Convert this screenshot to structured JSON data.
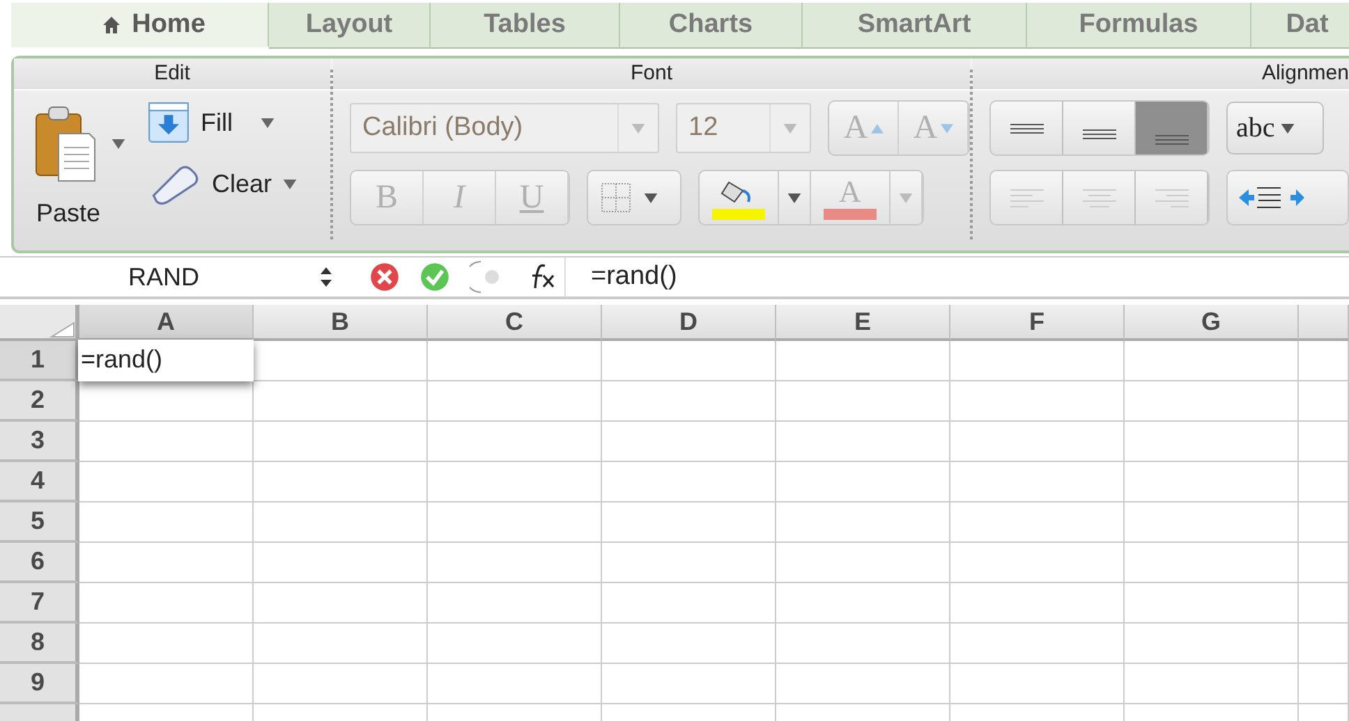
{
  "tabs": [
    {
      "label": "Home",
      "kind": "home",
      "selected": true
    },
    {
      "label": "Layout",
      "kind": "plain",
      "selected": false
    },
    {
      "label": "Tables",
      "kind": "plain",
      "selected": false
    },
    {
      "label": "Charts",
      "kind": "plain",
      "selected": false
    },
    {
      "label": "SmartArt",
      "kind": "plain",
      "selected": false
    },
    {
      "label": "Formulas",
      "kind": "plain",
      "selected": false
    },
    {
      "label": "Dat",
      "kind": "plain",
      "selected": false
    }
  ],
  "ribbon": {
    "edit": {
      "title": "Edit",
      "paste": "Paste",
      "fill": "Fill",
      "clear": "Clear"
    },
    "font": {
      "title": "Font",
      "font_name": "Calibri (Body)",
      "font_size": "12",
      "grow": "A",
      "shrink": "A",
      "bold": "B",
      "italic": "I",
      "underline": "U",
      "font_color": "A",
      "disabled": true
    },
    "alignment": {
      "title": "Alignmen",
      "vertical": [
        {
          "selected": false
        },
        {
          "selected": false
        },
        {
          "selected": true
        }
      ],
      "horizontal_disabled": true,
      "wrap": "abc"
    }
  },
  "formula_bar": {
    "name_box": "RAND",
    "formula": "=rand()"
  },
  "sheet": {
    "columns": [
      "A",
      "B",
      "C",
      "D",
      "E",
      "F",
      "G"
    ],
    "rows": [
      {
        "label": "1",
        "cells": [
          {
            "value": "=rand()",
            "selected": true
          }
        ]
      },
      {
        "label": "2"
      },
      {
        "label": "3"
      },
      {
        "label": "4"
      },
      {
        "label": "5"
      },
      {
        "label": "6"
      },
      {
        "label": "7"
      },
      {
        "label": "8"
      },
      {
        "label": "9"
      }
    ]
  }
}
